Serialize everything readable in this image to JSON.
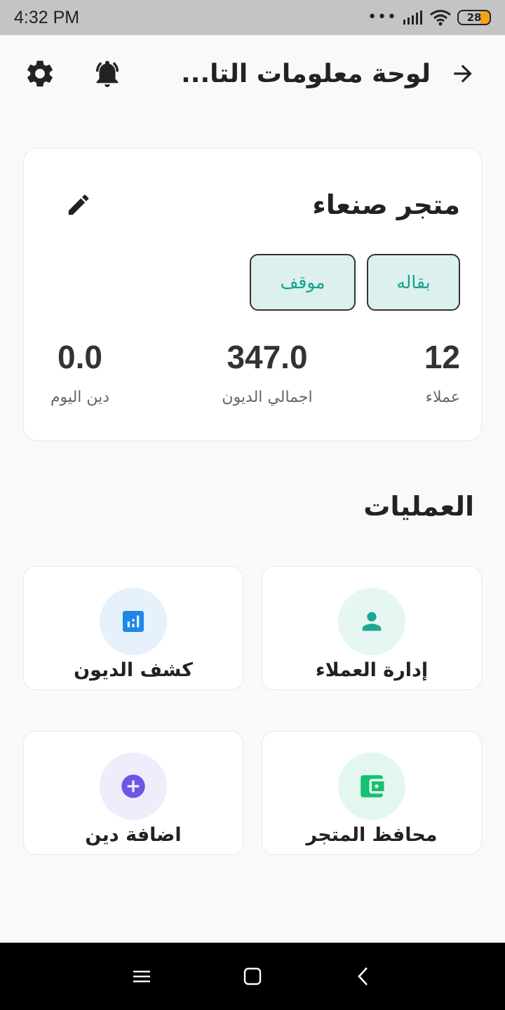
{
  "status_bar": {
    "time": "4:32  PM",
    "battery": "28"
  },
  "header": {
    "title": "لوحة معلومات التا..."
  },
  "store": {
    "name": "متجر صنعاء",
    "tags": [
      "بقاله",
      "موقف"
    ],
    "stats": {
      "customers": {
        "value": "12",
        "label": "عملاء"
      },
      "total_debts": {
        "value": "347.0",
        "label": "اجمالي الديون"
      },
      "today_debt": {
        "value": "0.0",
        "label": "دين اليوم"
      }
    }
  },
  "operations": {
    "title": "العمليات",
    "items": [
      {
        "label": "إدارة العملاء",
        "icon": "person-icon",
        "color": "#1aa891",
        "bg": "#e6f6f3"
      },
      {
        "label": "كشف الديون",
        "icon": "bar-chart-icon",
        "color": "#1e88e5",
        "bg": "#e6f1fb"
      },
      {
        "label": "محافظ المتجر",
        "icon": "wallet-icon",
        "color": "#16c172",
        "bg": "#e3f7ee"
      },
      {
        "label": "اضافة دين",
        "icon": "add-circle-icon",
        "color": "#6b56e6",
        "bg": "#efedfb"
      }
    ]
  }
}
